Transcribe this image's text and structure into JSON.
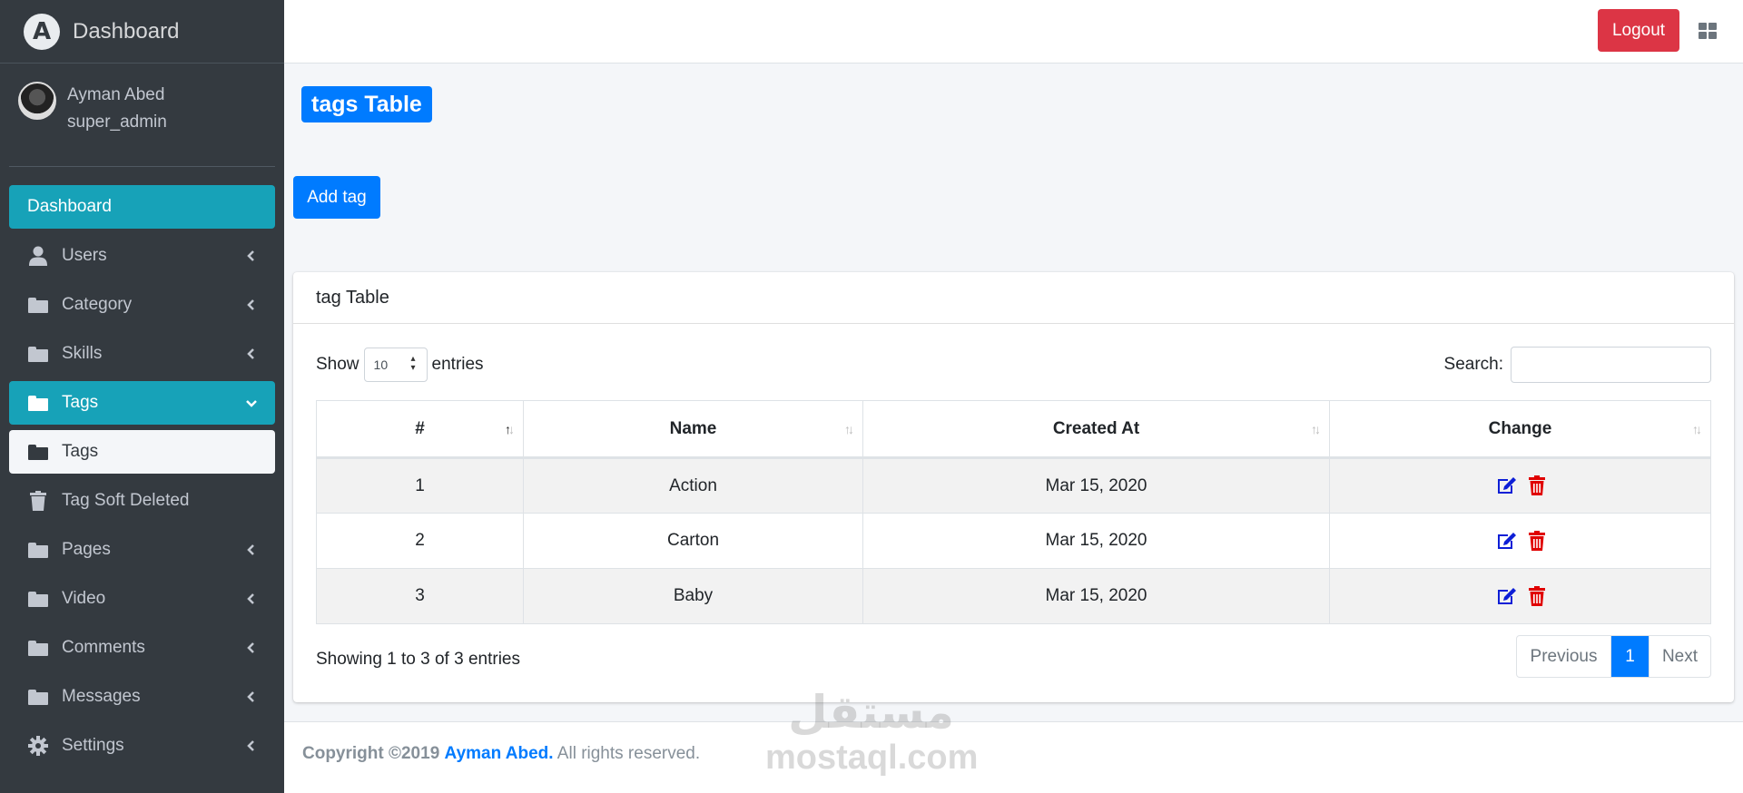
{
  "brand": {
    "logo_letter": "A",
    "name": "Dashboard"
  },
  "user": {
    "name": "Ayman Abed",
    "role": "super_admin"
  },
  "sidebar": {
    "items": [
      {
        "label": "Dashboard",
        "icon": "none",
        "state": "active"
      },
      {
        "label": "Users",
        "icon": "user-icon",
        "state": "collapsed"
      },
      {
        "label": "Category",
        "icon": "folder-icon",
        "state": "collapsed"
      },
      {
        "label": "Skills",
        "icon": "folder-icon",
        "state": "collapsed"
      },
      {
        "label": "Tags",
        "icon": "folder-icon",
        "state": "expanded-active"
      },
      {
        "label": "Tags",
        "icon": "folder-icon",
        "state": "sub-active"
      },
      {
        "label": "Tag Soft Deleted",
        "icon": "trash-icon",
        "state": "normal"
      },
      {
        "label": "Pages",
        "icon": "folder-icon",
        "state": "collapsed"
      },
      {
        "label": "Video",
        "icon": "folder-icon",
        "state": "collapsed"
      },
      {
        "label": "Comments",
        "icon": "folder-icon",
        "state": "collapsed"
      },
      {
        "label": "Messages",
        "icon": "folder-icon",
        "state": "collapsed"
      },
      {
        "label": "Settings",
        "icon": "gear-icon",
        "state": "collapsed"
      }
    ]
  },
  "topbar": {
    "logout_label": "Logout"
  },
  "page": {
    "title": "tags Table",
    "add_button": "Add tag"
  },
  "card": {
    "title": "tag Table",
    "show_label": "Show",
    "entries_value": "10",
    "entries_label": "entries",
    "search_label": "Search:",
    "search_value": ""
  },
  "table": {
    "headers": [
      "#",
      "Name",
      "Created At",
      "Change"
    ],
    "rows": [
      {
        "id": "1",
        "name": "Action",
        "created": "Mar 15, 2020"
      },
      {
        "id": "2",
        "name": "Carton",
        "created": "Mar 15, 2020"
      },
      {
        "id": "3",
        "name": "Baby",
        "created": "Mar 15, 2020"
      }
    ]
  },
  "pagination": {
    "info": "Showing 1 to 3 of 3 entries",
    "previous": "Previous",
    "current": "1",
    "next": "Next"
  },
  "footer": {
    "prefix": "Copyright ©2019",
    "author": "Ayman Abed.",
    "suffix": "All rights reserved."
  },
  "watermark": {
    "arabic": "مستقل",
    "latin": "mostaql.com"
  },
  "colors": {
    "sidebar_bg": "#343a40",
    "active_teal": "#17a2b8",
    "primary": "#007bff",
    "danger": "#dc3545",
    "edit_icon": "#0d1fd6",
    "delete_icon": "#e00000"
  }
}
